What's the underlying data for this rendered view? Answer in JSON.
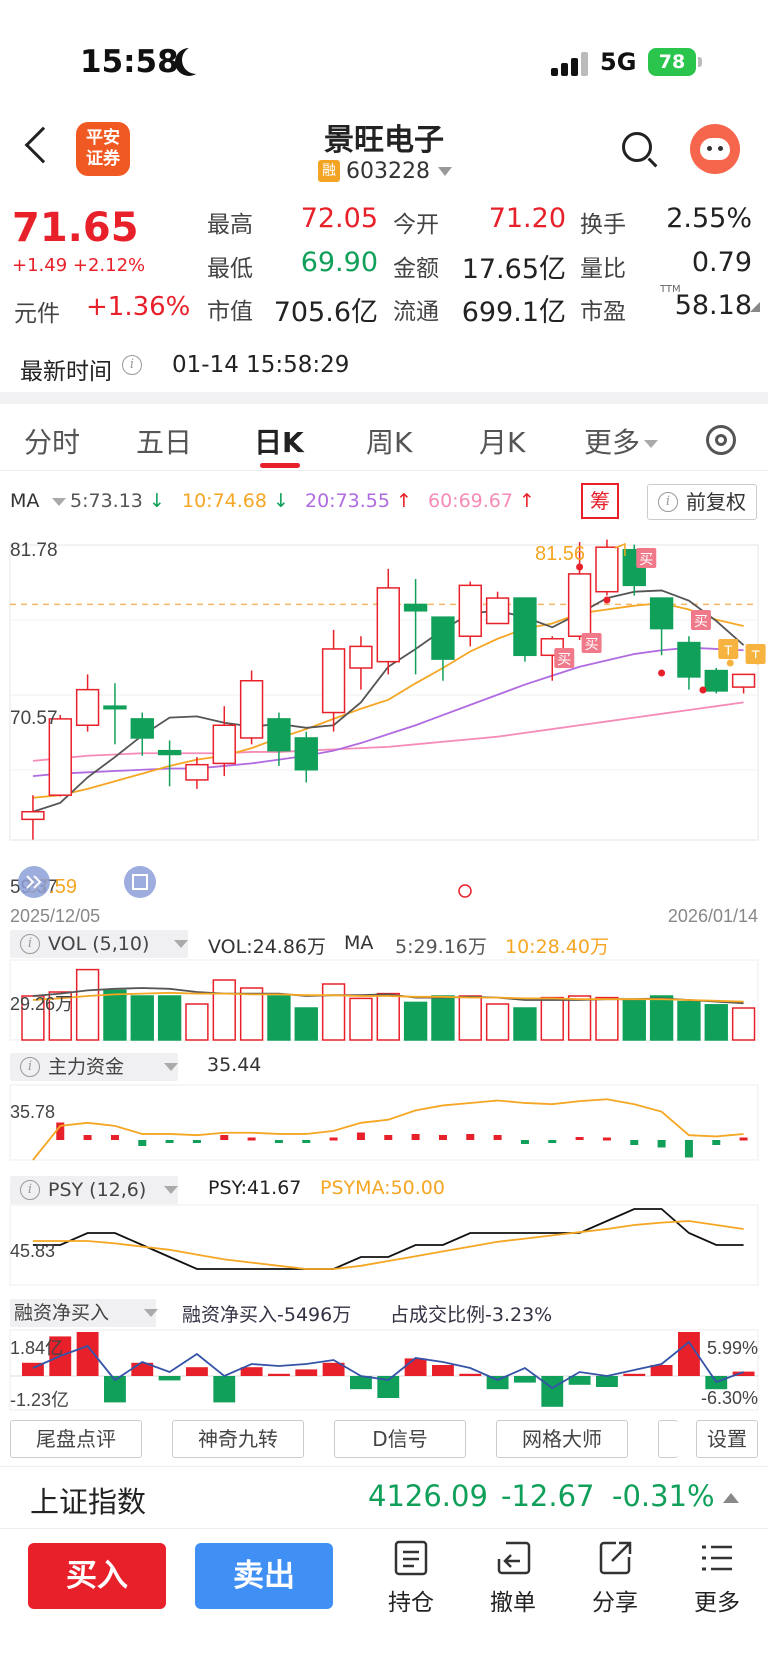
{
  "status_bar": {
    "time": "15:58",
    "network": "5G",
    "battery": "78"
  },
  "header": {
    "app_logo": "平安\n证券",
    "stock_name": "景旺电子",
    "badge": "融",
    "stock_code": "603228"
  },
  "quote": {
    "price": "71.65",
    "change": "+1.49 +2.12%",
    "yuanjian_label": "元件",
    "yuanjian_value": "+1.36%",
    "cells": [
      {
        "label": "最高",
        "value": "72.05",
        "color": "#e8202a"
      },
      {
        "label": "今开",
        "value": "71.20",
        "color": "#e8202a"
      },
      {
        "label": "换手",
        "value": "2.55%",
        "color": "#222222"
      },
      {
        "label": "最低",
        "value": "69.90",
        "color": "#11a05a"
      },
      {
        "label": "金额",
        "value": "17.65亿",
        "color": "#222222"
      },
      {
        "label": "量比",
        "value": "0.79",
        "color": "#222222"
      },
      {
        "label": "市值",
        "value": "705.6亿",
        "color": "#222222"
      },
      {
        "label": "流通",
        "value": "699.1亿",
        "color": "#222222"
      },
      {
        "label": "市盈",
        "value": "58.18",
        "color": "#222222"
      }
    ],
    "ttm": "TTM",
    "update_label": "最新时间",
    "update_time": "01-14 15:58:29"
  },
  "tabs": [
    {
      "label": "分时"
    },
    {
      "label": "五日"
    },
    {
      "label": "日K"
    },
    {
      "label": "周K"
    },
    {
      "label": "月K"
    },
    {
      "label": "更多"
    }
  ],
  "ma_row": {
    "ma_label": "MA",
    "ma5": "5:73.13",
    "ma10": "10:74.68",
    "ma20": "20:73.55",
    "ma60": "60:69.67",
    "chou": "筹",
    "fuquan": "前复权"
  },
  "kline": {
    "y_top_label": "81.78",
    "y_mid_label": "70.57",
    "y_low_label": "59.37",
    "low_marker": "57.59",
    "high_marker": "81.56",
    "start_date": "2025/12/05",
    "end_date": "2026/01/14",
    "buy_tag": "买",
    "t_tag": "T",
    "y_min": 59.37,
    "y_max": 81.78,
    "dashed_level": 77.5,
    "candles": [
      [
        60.6,
        61.2,
        59.0,
        62.5
      ],
      [
        62.5,
        68.5,
        62.4,
        68.8
      ],
      [
        68.0,
        70.8,
        67.5,
        72.0
      ],
      [
        69.5,
        69.3,
        66.5,
        71.3
      ],
      [
        68.5,
        67.0,
        65.6,
        69.0
      ],
      [
        66.0,
        65.7,
        63.2,
        66.8
      ],
      [
        63.7,
        64.9,
        63.0,
        65.5
      ],
      [
        65.0,
        68.0,
        64.0,
        69.5
      ],
      [
        67.0,
        71.5,
        66.5,
        72.3
      ],
      [
        68.5,
        66.0,
        64.8,
        69.0
      ],
      [
        67.0,
        64.5,
        63.5,
        67.5
      ],
      [
        69.0,
        74.0,
        67.5,
        75.5
      ],
      [
        72.5,
        74.2,
        70.8,
        75.0
      ],
      [
        73.0,
        78.8,
        72.0,
        80.3
      ],
      [
        77.5,
        77.0,
        72.0,
        79.5
      ],
      [
        76.5,
        73.2,
        71.5,
        76.5
      ],
      [
        75.0,
        79.0,
        74.2,
        79.3
      ],
      [
        76.0,
        78.0,
        76.0,
        78.5
      ],
      [
        78.0,
        73.5,
        73.0,
        78.0
      ],
      [
        73.5,
        74.8,
        71.5,
        75.0
      ],
      [
        75.0,
        79.9,
        74.7,
        82.4
      ],
      [
        78.5,
        82.0,
        78.2,
        82.6
      ],
      [
        81.8,
        79.0,
        78.2,
        82.2
      ],
      [
        78.0,
        75.6,
        73.5,
        78.0
      ],
      [
        74.5,
        71.8,
        70.8,
        75.0
      ],
      [
        72.3,
        70.7,
        70.5,
        72.5
      ],
      [
        71.0,
        72.0,
        70.5,
        72.0
      ]
    ],
    "ma5": [
      61.2,
      61.9,
      63.9,
      65.5,
      67.2,
      68.6,
      68.7,
      68.2,
      67.9,
      68.1,
      67.8,
      68.0,
      69.8,
      72.6,
      74.0,
      75.5,
      76.8,
      77.0,
      76.5,
      75.7,
      76.8,
      78.0,
      78.5,
      78.6,
      77.8,
      76.2,
      74.3
    ],
    "ma10": [
      62.3,
      62.5,
      63.0,
      63.6,
      64.2,
      64.8,
      65.3,
      65.6,
      66.2,
      67.0,
      67.7,
      68.5,
      69.3,
      70.0,
      71.3,
      72.5,
      73.8,
      74.8,
      75.6,
      76.0,
      76.8,
      77.1,
      77.4,
      77.6,
      77.1,
      76.3,
      75.8
    ],
    "ma20": [
      64.0,
      64.2,
      64.3,
      64.4,
      64.5,
      64.6,
      64.6,
      64.8,
      65.0,
      65.3,
      65.6,
      66.0,
      66.6,
      67.3,
      68.0,
      68.8,
      69.6,
      70.4,
      71.2,
      71.9,
      72.6,
      73.1,
      73.6,
      73.9,
      74.1,
      74.0,
      73.9
    ],
    "ma60": [
      65.2,
      65.4,
      65.6,
      65.7,
      65.8,
      65.8,
      65.8,
      65.8,
      65.9,
      65.9,
      66.0,
      66.1,
      66.2,
      66.3,
      66.5,
      66.7,
      66.9,
      67.1,
      67.4,
      67.7,
      68.0,
      68.3,
      68.6,
      68.9,
      69.2,
      69.5,
      69.8
    ]
  },
  "vol_panel": {
    "label": "VOL (5,10)",
    "vol": "VOL:24.86万",
    "ma_label": "MA",
    "ma5": "5:29.16万",
    "ma10": "10:28.40万",
    "axis_label": "29.26万",
    "bars": [
      0.55,
      0.6,
      0.88,
      0.62,
      0.55,
      0.55,
      0.45,
      0.75,
      0.65,
      0.55,
      0.4,
      0.7,
      0.52,
      0.58,
      0.47,
      0.55,
      0.55,
      0.45,
      0.4,
      0.53,
      0.55,
      0.53,
      0.5,
      0.55,
      0.48,
      0.44,
      0.4
    ],
    "ma5_line": [
      0.55,
      0.58,
      0.62,
      0.64,
      0.65,
      0.64,
      0.6,
      0.58,
      0.58,
      0.58,
      0.55,
      0.56,
      0.56,
      0.57,
      0.53,
      0.53,
      0.54,
      0.53,
      0.5,
      0.5,
      0.5,
      0.51,
      0.51,
      0.52,
      0.5,
      0.48,
      0.46
    ],
    "ma10_line": [
      0.5,
      0.52,
      0.55,
      0.57,
      0.58,
      0.59,
      0.58,
      0.58,
      0.57,
      0.57,
      0.56,
      0.56,
      0.55,
      0.55,
      0.54,
      0.54,
      0.53,
      0.53,
      0.52,
      0.52,
      0.51,
      0.51,
      0.51,
      0.51,
      0.5,
      0.49,
      0.48
    ]
  },
  "zlzj_panel": {
    "label": "主力资金",
    "value": "35.44",
    "axis_label": "35.78",
    "line": [
      0.0,
      0.55,
      0.6,
      0.55,
      0.42,
      0.42,
      0.4,
      0.44,
      0.44,
      0.42,
      0.42,
      0.47,
      0.6,
      0.65,
      0.8,
      0.88,
      0.92,
      0.96,
      0.92,
      0.9,
      0.95,
      0.98,
      0.9,
      0.78,
      0.4,
      0.38,
      0.42
    ],
    "bars": [
      0.0,
      0.35,
      0.1,
      0.1,
      -0.12,
      -0.05,
      -0.05,
      0.1,
      0.05,
      -0.05,
      -0.05,
      0.05,
      0.15,
      0.1,
      0.12,
      0.1,
      0.12,
      0.1,
      -0.08,
      -0.05,
      0.06,
      0.05,
      -0.1,
      -0.15,
      -0.35,
      -0.1,
      0.05
    ]
  },
  "psy_panel": {
    "label": "PSY (12,6)",
    "psy": "PSY:41.67",
    "psyma": "PSYMA:50.00",
    "axis_label": "45.83",
    "psy_line": [
      0.5,
      0.5,
      0.65,
      0.65,
      0.5,
      0.35,
      0.2,
      0.2,
      0.2,
      0.2,
      0.2,
      0.2,
      0.35,
      0.35,
      0.5,
      0.5,
      0.65,
      0.65,
      0.65,
      0.65,
      0.65,
      0.8,
      0.95,
      0.95,
      0.65,
      0.5,
      0.5
    ],
    "psyma_line": [
      0.55,
      0.55,
      0.55,
      0.52,
      0.48,
      0.44,
      0.38,
      0.32,
      0.28,
      0.24,
      0.2,
      0.2,
      0.24,
      0.3,
      0.36,
      0.42,
      0.48,
      0.54,
      0.58,
      0.62,
      0.66,
      0.7,
      0.75,
      0.78,
      0.8,
      0.75,
      0.7
    ]
  },
  "rz_panel": {
    "label": "融资净买入",
    "text1": "融资净买入-5496万",
    "text2": "占成交比例-3.23%",
    "axis_top": "1.84亿",
    "axis_bottom": "-1.23亿",
    "right_top": "5.99%",
    "right_bottom": "-6.30%",
    "bars": [
      0.3,
      0.9,
      1.0,
      -0.6,
      0.3,
      -0.1,
      0.2,
      -0.6,
      0.2,
      0.05,
      0.15,
      0.3,
      -0.3,
      -0.5,
      0.4,
      0.25,
      0.05,
      -0.3,
      -0.15,
      -0.7,
      -0.2,
      -0.25,
      0.05,
      0.25,
      1.0,
      -0.3,
      0.1
    ],
    "line": [
      0.2,
      0.5,
      0.75,
      -0.1,
      0.35,
      0.1,
      0.55,
      0.0,
      0.3,
      0.25,
      0.3,
      0.4,
      0.0,
      -0.1,
      0.45,
      0.35,
      0.2,
      -0.1,
      0.2,
      -0.3,
      0.1,
      0.0,
      0.15,
      0.3,
      0.85,
      -0.15,
      0.1
    ]
  },
  "tools": [
    "尾盘点评",
    "神奇九转",
    "D信号",
    "网格大师",
    "",
    "设置"
  ],
  "index_row": {
    "name": "上证指数",
    "value": "4126.09",
    "change": "-12.67",
    "pct": "-0.31%"
  },
  "bottom_bar": {
    "buy": "买入",
    "sell": "卖出",
    "items": [
      {
        "label": "持仓"
      },
      {
        "label": "撤单"
      },
      {
        "label": "分享"
      },
      {
        "label": "更多"
      }
    ]
  },
  "colors": {
    "up": "#e8202a",
    "down": "#11a05a",
    "ma5": "#555555",
    "ma10": "#f5a623",
    "ma20": "#b06be0",
    "ma60": "#f58cb8"
  }
}
